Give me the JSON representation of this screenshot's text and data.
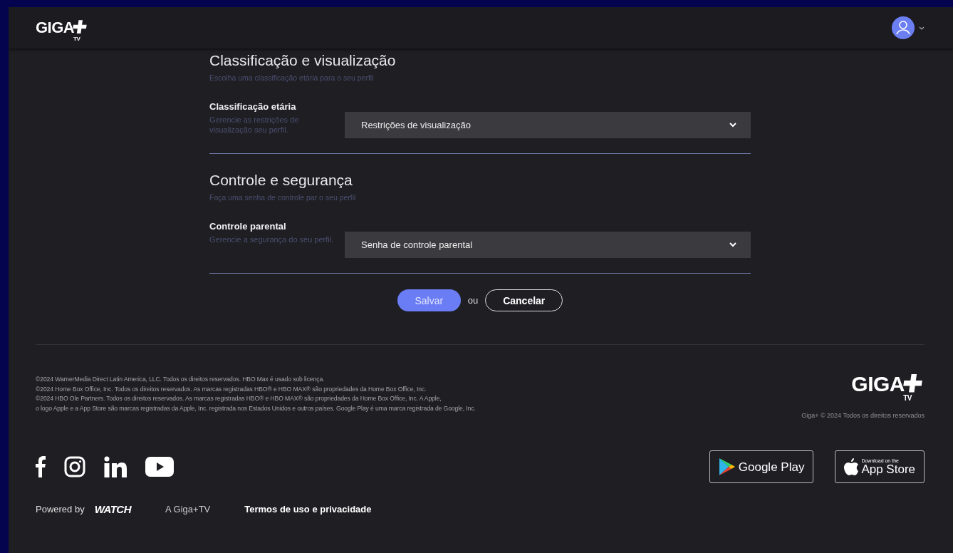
{
  "header": {
    "logo": {
      "text": "GIGA",
      "sub": "TV"
    }
  },
  "sections": [
    {
      "title": "Classificação e visualização",
      "subtitle": "Escolha uma classificação etária para o seu perfil",
      "field": {
        "label": "Classificação etária",
        "hint": "Gerencie as restrições de visualização seu perfil.",
        "value": "Restrições de visualização"
      }
    },
    {
      "title": "Controle e segurança",
      "subtitle": "Faça uma senha de controle par o seu perfil",
      "field": {
        "label": "Controle parental",
        "hint": "Gerencie a segurança do seu perfil.",
        "value": "Senha de controle parental"
      }
    }
  ],
  "actions": {
    "save": "Salvar",
    "or": "ou",
    "cancel": "Cancelar"
  },
  "footer": {
    "legal": [
      "©2024 WarnerMedia Direct Latin America, LLC. Todos os direitos reservados. HBO Max é usado sob licença.",
      "©2024 Home Box Office, Inc. Todos os direitos reservados. As marcas registradas HBO® e HBO MAX® são propriedades da Home Box Office, Inc.",
      "©2024 HBO Ole Partners. Todos os direitos reservados. As marcas registradas HBO® e HBO MAX® são propriedades da Home Box Office, Inc. A Apple,",
      "o logo Apple e a App Store são marcas registradas da Apple, Inc. registrada nos Estados Unidos e outros países. Google Play é uma marca registrada de Google, Inc."
    ],
    "logo": {
      "text": "GIGA",
      "sub": "TV"
    },
    "copyright": "Giga+ © 2024 Todos os direitos reservados",
    "social": [
      {
        "kind": "facebook"
      },
      {
        "kind": "instagram"
      },
      {
        "kind": "linkedin"
      },
      {
        "kind": "youtube"
      }
    ],
    "stores": [
      {
        "kind": "google",
        "title": "Google Play"
      },
      {
        "kind": "apple",
        "small": "Download on the",
        "title": "App Store"
      }
    ],
    "powered_by": "Powered by",
    "brand": "WATCH",
    "links": [
      "A Giga+TV",
      "Termos de uso e privacidade"
    ]
  }
}
